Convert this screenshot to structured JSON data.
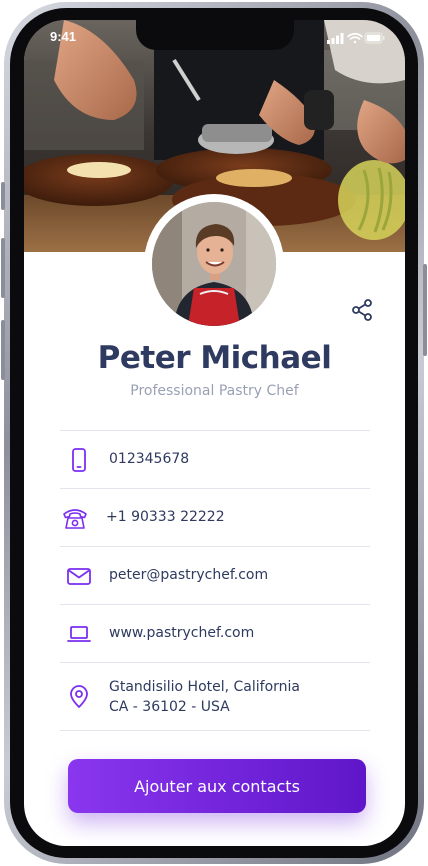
{
  "status_bar": {
    "time": "9:41"
  },
  "profile": {
    "name": "Peter Michael",
    "title": "Professional Pastry Chef"
  },
  "contacts": [
    {
      "icon": "mobile-phone-icon",
      "value": "012345678"
    },
    {
      "icon": "landline-phone-icon",
      "value": "+1 90333 22222"
    },
    {
      "icon": "email-icon",
      "value": "peter@pastrychef.com"
    },
    {
      "icon": "laptop-icon",
      "value": "www.pastrychef.com"
    },
    {
      "icon": "location-pin-icon",
      "line1": "Gtandisilio Hotel, California",
      "line2": "CA - 36102 - USA"
    }
  ],
  "cta": {
    "label": "Ajouter aux contacts"
  },
  "colors": {
    "accent": "#7B2FF0",
    "text": "#2E3A5F",
    "muted": "#9AA0B4"
  }
}
